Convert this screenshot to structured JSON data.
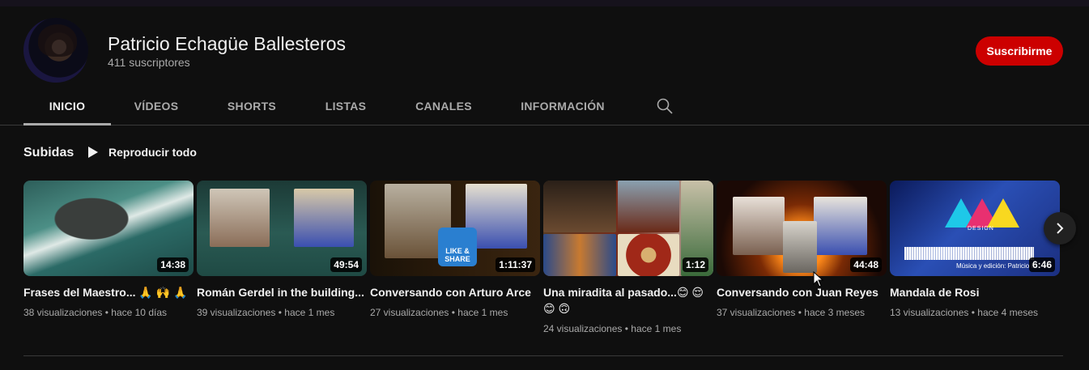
{
  "channel": {
    "name": "Patricio Echagüe Ballesteros",
    "subscribers": "411 suscriptores",
    "subscribe_label": "Suscribirme"
  },
  "tabs": [
    {
      "label": "INICIO",
      "active": true
    },
    {
      "label": "VÍDEOS",
      "active": false
    },
    {
      "label": "SHORTS",
      "active": false
    },
    {
      "label": "LISTAS",
      "active": false
    },
    {
      "label": "CANALES",
      "active": false
    },
    {
      "label": "INFORMACIÓN",
      "active": false
    }
  ],
  "section": {
    "title": "Subidas",
    "play_all_label": "Reproducir todo"
  },
  "videos": [
    {
      "title": "Frases del Maestro... 🙏 🙌 🙏",
      "duration": "14:38",
      "views": "38 visualizaciones",
      "age": "hace 10 días"
    },
    {
      "title": "Román Gerdel in the building...",
      "duration": "49:54",
      "views": "39 visualizaciones",
      "age": "hace 1 mes"
    },
    {
      "title": "Conversando con Arturo Arce",
      "duration": "1:11:37",
      "views": "27 visualizaciones",
      "age": "hace 1 mes",
      "overlay_text": "LIKE & SHARE"
    },
    {
      "title": "Una miradita al pasado...😊 😌 😊 🙃",
      "duration": "1:12",
      "views": "24 visualizaciones",
      "age": "hace 1 mes"
    },
    {
      "title": "Conversando con Juan Reyes",
      "duration": "44:48",
      "views": "37 visualizaciones",
      "age": "hace 3 meses"
    },
    {
      "title": "Mandala de Rosi",
      "duration": "6:46",
      "views": "13 visualizaciones",
      "age": "hace 4 meses",
      "overlay_text": "DESIGN",
      "overlay_caption": "Música y edición: Patricio E"
    }
  ],
  "meta_separator": "•",
  "colors": {
    "background": "#0f0f0f",
    "subscribe": "#cc0000",
    "muted_text": "#aaaaaa"
  },
  "icons": {
    "search": "search-icon",
    "play": "play-icon",
    "next": "chevron-right-icon"
  }
}
